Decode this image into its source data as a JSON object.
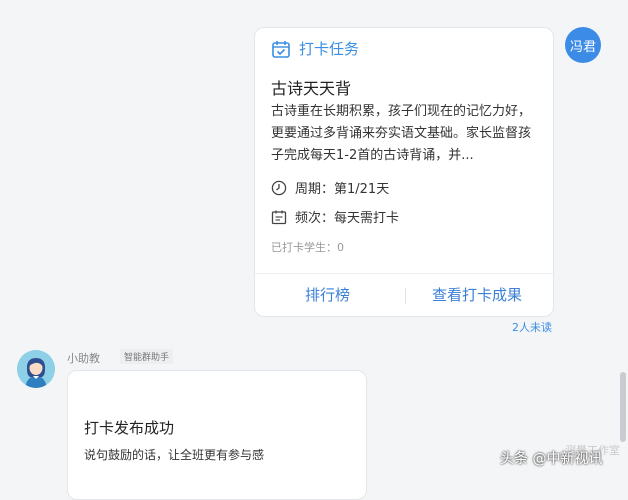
{
  "sender_avatar": {
    "text": "冯君"
  },
  "task_card": {
    "header_label": "打卡任务",
    "title": "古诗天天背",
    "description": "古诗重在长期积累，孩子们现在的记忆力好，更要通过多背诵来夯实语文基础。家长监督孩子完成每天1-2首的古诗背诵，并...",
    "period": "周期：第1/21天",
    "frequency": "频次：每天需打卡",
    "checked_in": "已打卡学生：0",
    "btn_rank": "排行榜",
    "btn_results": "查看打卡成果"
  },
  "unread": "2人未读",
  "bot": {
    "name": "小助教",
    "tag": "智能群助手",
    "message_title": "打卡发布成功",
    "message_sub": "说句鼓励的话，让全班更有参与感"
  },
  "watermark": {
    "text": "头条 @中新视讯",
    "faint": "测量工作室"
  },
  "colors": {
    "accent": "#3a8fe2",
    "avatar": "#3c8be6",
    "background": "#f4f5f7"
  }
}
